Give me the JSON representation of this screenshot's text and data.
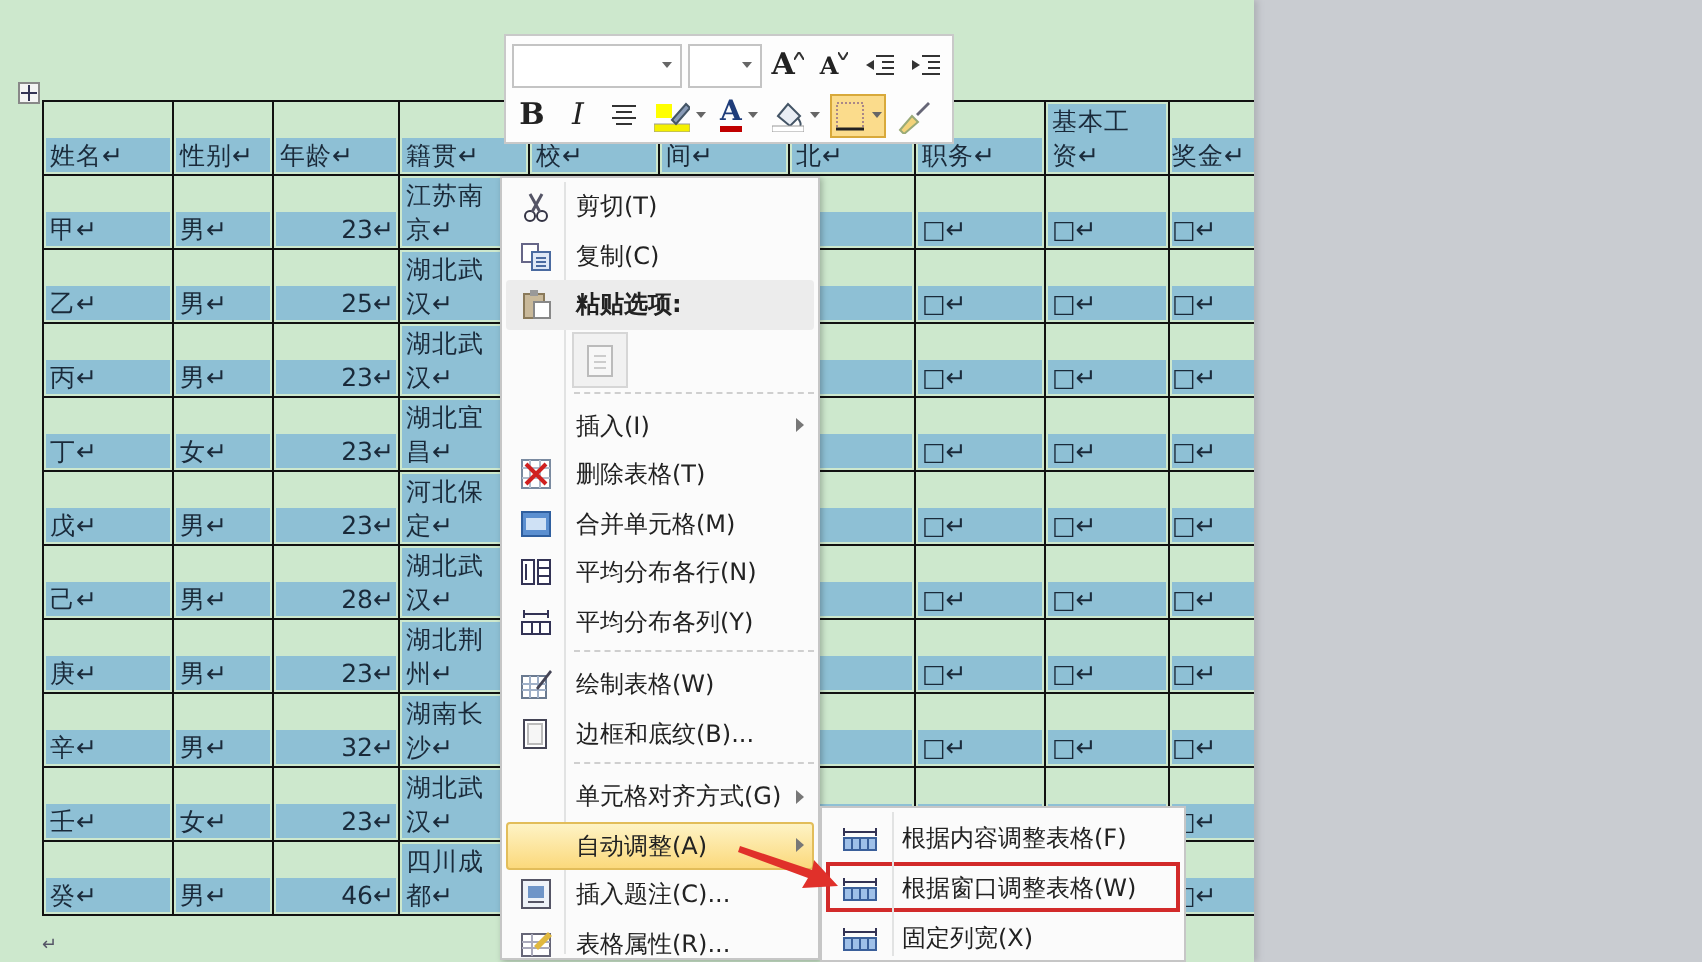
{
  "document": {
    "table": {
      "columns": [
        "姓名↵",
        "性别↵",
        "年龄↵",
        "籍贯↵",
        "校↵",
        "间↵",
        "北↵",
        "职务↵",
        "基本工资↵",
        "奖金↵"
      ],
      "rows": [
        {
          "cells": [
            "甲↵",
            "男↵",
            "23↵",
            "江苏南京↵",
            null,
            null,
            null,
            "□↵",
            "□↵",
            "□↵"
          ]
        },
        {
          "cells": [
            "乙↵",
            "男↵",
            "25↵",
            "湖北武汉↵",
            null,
            null,
            null,
            "□↵",
            "□↵",
            "□↵"
          ]
        },
        {
          "cells": [
            "丙↵",
            "男↵",
            "23↵",
            "湖北武汉↵",
            null,
            null,
            null,
            "□↵",
            "□↵",
            "□↵"
          ]
        },
        {
          "cells": [
            "丁↵",
            "女↵",
            "23↵",
            "湖北宜昌↵",
            null,
            null,
            null,
            "□↵",
            "□↵",
            "□↵"
          ]
        },
        {
          "cells": [
            "戊↵",
            "男↵",
            "23↵",
            "河北保定↵",
            null,
            null,
            null,
            "□↵",
            "□↵",
            "□↵"
          ]
        },
        {
          "cells": [
            "己↵",
            "男↵",
            "28↵",
            "湖北武汉↵",
            null,
            null,
            null,
            "□↵",
            "□↵",
            "□↵"
          ]
        },
        {
          "cells": [
            "庚↵",
            "男↵",
            "23↵",
            "湖北荆州↵",
            null,
            null,
            null,
            "□↵",
            "□↵",
            "□↵"
          ]
        },
        {
          "cells": [
            "辛↵",
            "男↵",
            "32↵",
            "湖南长沙↵",
            null,
            null,
            null,
            "□↵",
            "□↵",
            "□↵"
          ]
        },
        {
          "cells": [
            "壬↵",
            "女↵",
            "23↵",
            "湖北武汉↵",
            null,
            null,
            null,
            null,
            null,
            "□↵"
          ]
        },
        {
          "cells": [
            "癸↵",
            "男↵",
            "46↵",
            "四川成都↵",
            null,
            null,
            null,
            null,
            null,
            "□↵"
          ]
        }
      ]
    },
    "trailing_mark": "↵"
  },
  "mini_toolbar": {
    "row_1": [
      {
        "kind": "font-name"
      },
      {
        "kind": "font-size"
      },
      {
        "kind": "grow",
        "label": "A"
      },
      {
        "kind": "shrink",
        "label": "A"
      },
      {
        "kind": "outdent"
      },
      {
        "kind": "indent"
      }
    ],
    "row_2": [
      {
        "kind": "bold",
        "label": "B",
        "selected": false
      },
      {
        "kind": "italic",
        "label": "I",
        "selected": false
      },
      {
        "kind": "center",
        "selected": false
      },
      {
        "kind": "highlight",
        "selected": false
      },
      {
        "kind": "font-color",
        "label": "A",
        "selected": false
      },
      {
        "kind": "shading",
        "selected": false
      },
      {
        "kind": "borders",
        "selected": true
      },
      {
        "kind": "painter",
        "selected": false
      }
    ]
  },
  "context_menu": [
    {
      "kind": "cut",
      "label": "剪切(T)"
    },
    {
      "kind": "copy",
      "label": "复制(C)"
    },
    {
      "kind": "paste-heading",
      "label": "粘贴选项:"
    },
    {
      "kind": "paste-button"
    },
    {
      "kind": "separator"
    },
    {
      "kind": "plain",
      "label": "插入(I)",
      "submenu": true,
      "highlighted": false
    },
    {
      "kind": "delete-table",
      "label": "删除表格(T)"
    },
    {
      "kind": "merge",
      "label": "合并单元格(M)"
    },
    {
      "kind": "rows",
      "label": "平均分布各行(N)"
    },
    {
      "kind": "cols",
      "label": "平均分布各列(Y)"
    },
    {
      "kind": "separator"
    },
    {
      "kind": "draw",
      "label": "绘制表格(W)"
    },
    {
      "kind": "border",
      "label": "边框和底纹(B)..."
    },
    {
      "kind": "separator"
    },
    {
      "kind": "plain",
      "label": "单元格对齐方式(G)",
      "submenu": true,
      "highlighted": false
    },
    {
      "kind": "plain",
      "label": "自动调整(A)",
      "submenu": true,
      "highlighted": true
    },
    {
      "kind": "caption",
      "label": "插入题注(C)..."
    },
    {
      "kind": "props",
      "label": "表格属性(R)..."
    }
  ],
  "submenu": [
    {
      "label": "根据内容调整表格(F)",
      "marked": false
    },
    {
      "label": "根据窗口调整表格(W)",
      "marked": true
    },
    {
      "label": "固定列宽(X)",
      "marked": false
    }
  ]
}
